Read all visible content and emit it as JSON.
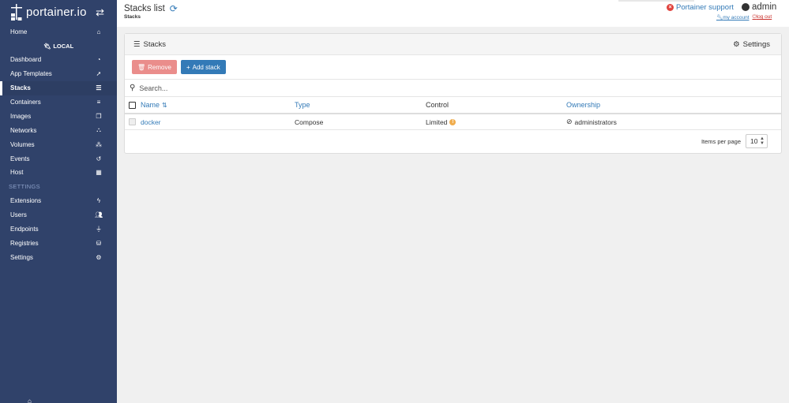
{
  "brand": {
    "logo_text": "portainer.io",
    "swap_icon": "exchange-icon"
  },
  "sidebar": {
    "home": "Home",
    "endpoint_label": "LOCAL",
    "items": [
      {
        "label": "Dashboard",
        "icon": "tachometer-icon"
      },
      {
        "label": "App Templates",
        "icon": "rocket-icon"
      },
      {
        "label": "Stacks",
        "icon": "th-list-icon",
        "active": true
      },
      {
        "label": "Containers",
        "icon": "server-icon"
      },
      {
        "label": "Images",
        "icon": "clone-icon"
      },
      {
        "label": "Networks",
        "icon": "sitemap-icon"
      },
      {
        "label": "Volumes",
        "icon": "cubes-icon"
      },
      {
        "label": "Events",
        "icon": "history-icon"
      },
      {
        "label": "Host",
        "icon": "th-icon"
      }
    ],
    "settings_heading": "SETTINGS",
    "settings_items": [
      {
        "label": "Extensions",
        "icon": "bolt-icon"
      },
      {
        "label": "Users",
        "icon": "users-icon"
      },
      {
        "label": "Endpoints",
        "icon": "plug-icon"
      },
      {
        "label": "Registries",
        "icon": "database-icon"
      },
      {
        "label": "Settings",
        "icon": "cogs-icon"
      }
    ]
  },
  "header": {
    "title": "Stacks list",
    "breadcrumb": "Stacks",
    "support": "Portainer support",
    "username": "admin",
    "my_account": "my account",
    "log_out": "log out"
  },
  "widget": {
    "title": "Stacks",
    "settings": "Settings",
    "remove": "Remove",
    "add_stack": "Add stack",
    "search_placeholder": "Search...",
    "columns": {
      "name": "Name",
      "type": "Type",
      "control": "Control",
      "ownership": "Ownership"
    },
    "rows": [
      {
        "name": "docker",
        "type": "Compose",
        "control": "Limited",
        "ownership": "administrators"
      }
    ],
    "items_per_page_label": "Items per page",
    "items_per_page": "10"
  },
  "colors": {
    "sidebar": "#30426a",
    "accent": "#337ab7",
    "danger": "#e0433e",
    "warning": "#f0ad4e"
  }
}
